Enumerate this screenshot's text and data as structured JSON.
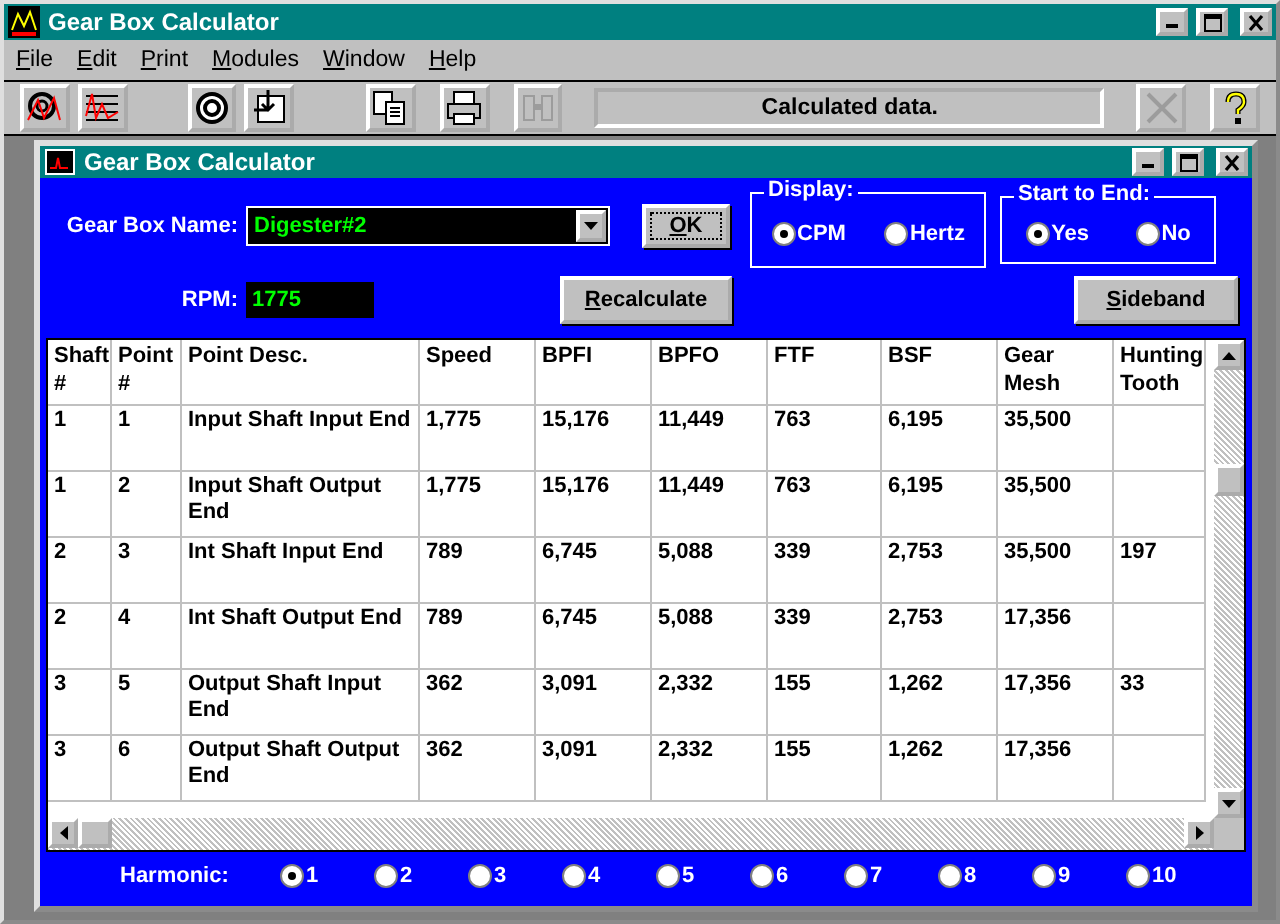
{
  "window": {
    "title": "Gear Box Calculator"
  },
  "menu": [
    {
      "label": "File"
    },
    {
      "label": "Edit"
    },
    {
      "label": "Print"
    },
    {
      "label": "Modules"
    },
    {
      "label": "Window"
    },
    {
      "label": "Help"
    }
  ],
  "toolbar": [
    {
      "kind": "target",
      "disabled": false
    },
    {
      "kind": "spectrum",
      "disabled": false
    },
    {
      "kind": "bearing",
      "disabled": false
    },
    {
      "kind": "import",
      "disabled": false
    },
    {
      "kind": "copy",
      "disabled": false
    },
    {
      "kind": "print",
      "disabled": false
    },
    {
      "kind": "binoculars",
      "disabled": true
    },
    {
      "kind": "status",
      "text": "Calculated data."
    },
    {
      "kind": "close",
      "disabled": true
    },
    {
      "kind": "help",
      "disabled": false
    }
  ],
  "child_window": {
    "title": "Gear Box Calculator"
  },
  "form": {
    "gear_box_name": {
      "label": "Gear Box Name:",
      "value": "Digester#2"
    },
    "rpm": {
      "label": "RPM:",
      "value": "1775"
    },
    "ok_button": "OK",
    "recalculate_button": "Recalculate",
    "sideband_button": "Sideband",
    "display": {
      "title": "Display:",
      "options": [
        {
          "label": "CPM",
          "selected": true
        },
        {
          "label": "Hertz",
          "selected": false
        }
      ]
    },
    "start_to_end": {
      "title": "Start to End:",
      "options": [
        {
          "label": "Yes",
          "selected": true
        },
        {
          "label": "No",
          "selected": false
        }
      ]
    }
  },
  "table": {
    "columns": [
      "Shaft #",
      "Point #",
      "Point Desc.",
      "Speed",
      "BPFI",
      "BPFO",
      "FTF",
      "BSF",
      "Gear Mesh",
      "Hunting Tooth"
    ],
    "rows": [
      [
        "1",
        "1",
        "Input Shaft Input End",
        "1,775",
        "15,176",
        "11,449",
        "763",
        "6,195",
        "35,500",
        ""
      ],
      [
        "1",
        "2",
        "Input Shaft Output End",
        "1,775",
        "15,176",
        "11,449",
        "763",
        "6,195",
        "35,500",
        ""
      ],
      [
        "2",
        "3",
        "Int Shaft Input End",
        "789",
        "6,745",
        "5,088",
        "339",
        "2,753",
        "35,500",
        "197"
      ],
      [
        "2",
        "4",
        "Int Shaft Output End",
        "789",
        "6,745",
        "5,088",
        "339",
        "2,753",
        "17,356",
        ""
      ],
      [
        "3",
        "5",
        "Output Shaft Input End",
        "362",
        "3,091",
        "2,332",
        "155",
        "1,262",
        "17,356",
        "33"
      ],
      [
        "3",
        "6",
        "Output Shaft Output End",
        "362",
        "3,091",
        "2,332",
        "155",
        "1,262",
        "17,356",
        ""
      ]
    ]
  },
  "harmonic": {
    "label": "Harmonic:",
    "options": [
      {
        "label": "1",
        "selected": true
      },
      {
        "label": "2",
        "selected": false
      },
      {
        "label": "3",
        "selected": false
      },
      {
        "label": "4",
        "selected": false
      },
      {
        "label": "5",
        "selected": false
      },
      {
        "label": "6",
        "selected": false
      },
      {
        "label": "7",
        "selected": false
      },
      {
        "label": "8",
        "selected": false
      },
      {
        "label": "9",
        "selected": false
      },
      {
        "label": "10",
        "selected": false
      }
    ]
  }
}
